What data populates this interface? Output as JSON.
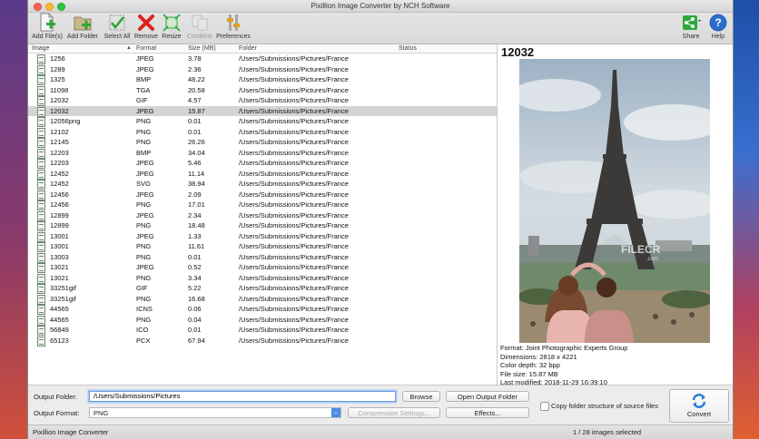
{
  "window": {
    "title": "Pixillion Image Converter by NCH Software"
  },
  "toolbar": {
    "add_files": "Add File(s)",
    "add_folder": "Add Folder",
    "select_all": "Select All",
    "remove": "Remove",
    "resize": "Resize",
    "combine": "Combine",
    "preferences": "Preferences",
    "share": "Share",
    "help": "Help"
  },
  "list": {
    "columns": {
      "image": "Image",
      "format": "Format",
      "size": "Size (MB)",
      "folder": "Folder",
      "status": "Status"
    },
    "rows": [
      {
        "name": "1256",
        "format": "JPEG",
        "size": "3.78",
        "folder": "/Users/Submissions/Pictures/France",
        "status": ""
      },
      {
        "name": "1289",
        "format": "JPEG",
        "size": "2.36",
        "folder": "/Users/Submissions/Pictures/France",
        "status": ""
      },
      {
        "name": "1325",
        "format": "BMP",
        "size": "48.22",
        "folder": "/Users/Submissions/Pictures/France",
        "status": ""
      },
      {
        "name": "11098",
        "format": "TGA",
        "size": "20.58",
        "folder": "/Users/Submissions/Pictures/France",
        "status": ""
      },
      {
        "name": "12032",
        "format": "GIF",
        "size": "4.57",
        "folder": "/Users/Submissions/Pictures/France",
        "status": ""
      },
      {
        "name": "12032",
        "format": "JPEG",
        "size": "15.87",
        "folder": "/Users/Submissions/Pictures/France",
        "status": ""
      },
      {
        "name": "12056png",
        "format": "PNG",
        "size": "0.01",
        "folder": "/Users/Submissions/Pictures/France",
        "status": ""
      },
      {
        "name": "12102",
        "format": "PNG",
        "size": "0.01",
        "folder": "/Users/Submissions/Pictures/France",
        "status": ""
      },
      {
        "name": "12145",
        "format": "PNG",
        "size": "26.26",
        "folder": "/Users/Submissions/Pictures/France",
        "status": ""
      },
      {
        "name": "12203",
        "format": "BMP",
        "size": "34.04",
        "folder": "/Users/Submissions/Pictures/France",
        "status": ""
      },
      {
        "name": "12203",
        "format": "JPEG",
        "size": "5.46",
        "folder": "/Users/Submissions/Pictures/France",
        "status": ""
      },
      {
        "name": "12452",
        "format": "JPEG",
        "size": "11.14",
        "folder": "/Users/Submissions/Pictures/France",
        "status": ""
      },
      {
        "name": "12452",
        "format": "SVG",
        "size": "38.94",
        "folder": "/Users/Submissions/Pictures/France",
        "status": ""
      },
      {
        "name": "12456",
        "format": "JPEG",
        "size": "2.09",
        "folder": "/Users/Submissions/Pictures/France",
        "status": ""
      },
      {
        "name": "12456",
        "format": "PNG",
        "size": "17.01",
        "folder": "/Users/Submissions/Pictures/France",
        "status": ""
      },
      {
        "name": "12899",
        "format": "JPEG",
        "size": "2.34",
        "folder": "/Users/Submissions/Pictures/France",
        "status": ""
      },
      {
        "name": "12899",
        "format": "PNG",
        "size": "18.48",
        "folder": "/Users/Submissions/Pictures/France",
        "status": ""
      },
      {
        "name": "13001",
        "format": "JPEG",
        "size": "1.33",
        "folder": "/Users/Submissions/Pictures/France",
        "status": ""
      },
      {
        "name": "13001",
        "format": "PNG",
        "size": "11.61",
        "folder": "/Users/Submissions/Pictures/France",
        "status": ""
      },
      {
        "name": "13003",
        "format": "PNG",
        "size": "0.01",
        "folder": "/Users/Submissions/Pictures/France",
        "status": ""
      },
      {
        "name": "13021",
        "format": "JPEG",
        "size": "0.52",
        "folder": "/Users/Submissions/Pictures/France",
        "status": ""
      },
      {
        "name": "13021",
        "format": "PNG",
        "size": "3.34",
        "folder": "/Users/Submissions/Pictures/France",
        "status": ""
      },
      {
        "name": "33251gif",
        "format": "GIF",
        "size": "5.22",
        "folder": "/Users/Submissions/Pictures/France",
        "status": ""
      },
      {
        "name": "33251gif",
        "format": "PNG",
        "size": "16.68",
        "folder": "/Users/Submissions/Pictures/France",
        "status": ""
      },
      {
        "name": "44565",
        "format": "ICNS",
        "size": "0.06",
        "folder": "/Users/Submissions/Pictures/France",
        "status": ""
      },
      {
        "name": "44565",
        "format": "PNG",
        "size": "0.04",
        "folder": "/Users/Submissions/Pictures/France",
        "status": ""
      },
      {
        "name": "56849",
        "format": "ICO",
        "size": "0.01",
        "folder": "/Users/Submissions/Pictures/France",
        "status": ""
      },
      {
        "name": "65123",
        "format": "PCX",
        "size": "67.94",
        "folder": "/Users/Submissions/Pictures/France",
        "status": ""
      }
    ],
    "selected_index": 5
  },
  "preview": {
    "title": "12032",
    "watermark": "FILECR",
    "watermark_sub": ".com",
    "format": "Format: Joint Photographic Experts Group",
    "dimensions": "Dimensions: 2818 x 4221",
    "color_depth": "Color depth: 32 bpp",
    "file_size": "File size: 15.87 MB",
    "last_modified": "Last modified: 2018-11-29 16:39:10"
  },
  "bottom": {
    "output_folder_label": "Output Folder:",
    "output_folder_value": "/Users/Submissions/Pictures",
    "browse": "Browse",
    "open_output_folder": "Open Output Folder",
    "output_format_label": "Output Format:",
    "output_format_value": "PNG",
    "compression_settings": "Compression Settings...",
    "effects": "Effects...",
    "copy_structure": "Copy folder structure of source files",
    "convert": "Convert"
  },
  "status": {
    "app_name": "Pixillion Image Converter",
    "selection": "1 / 28 images selected"
  },
  "colors": {
    "selected_row": "#d4d4d4",
    "accent_blue": "#4a8ee8",
    "remove_red": "#e02020"
  }
}
